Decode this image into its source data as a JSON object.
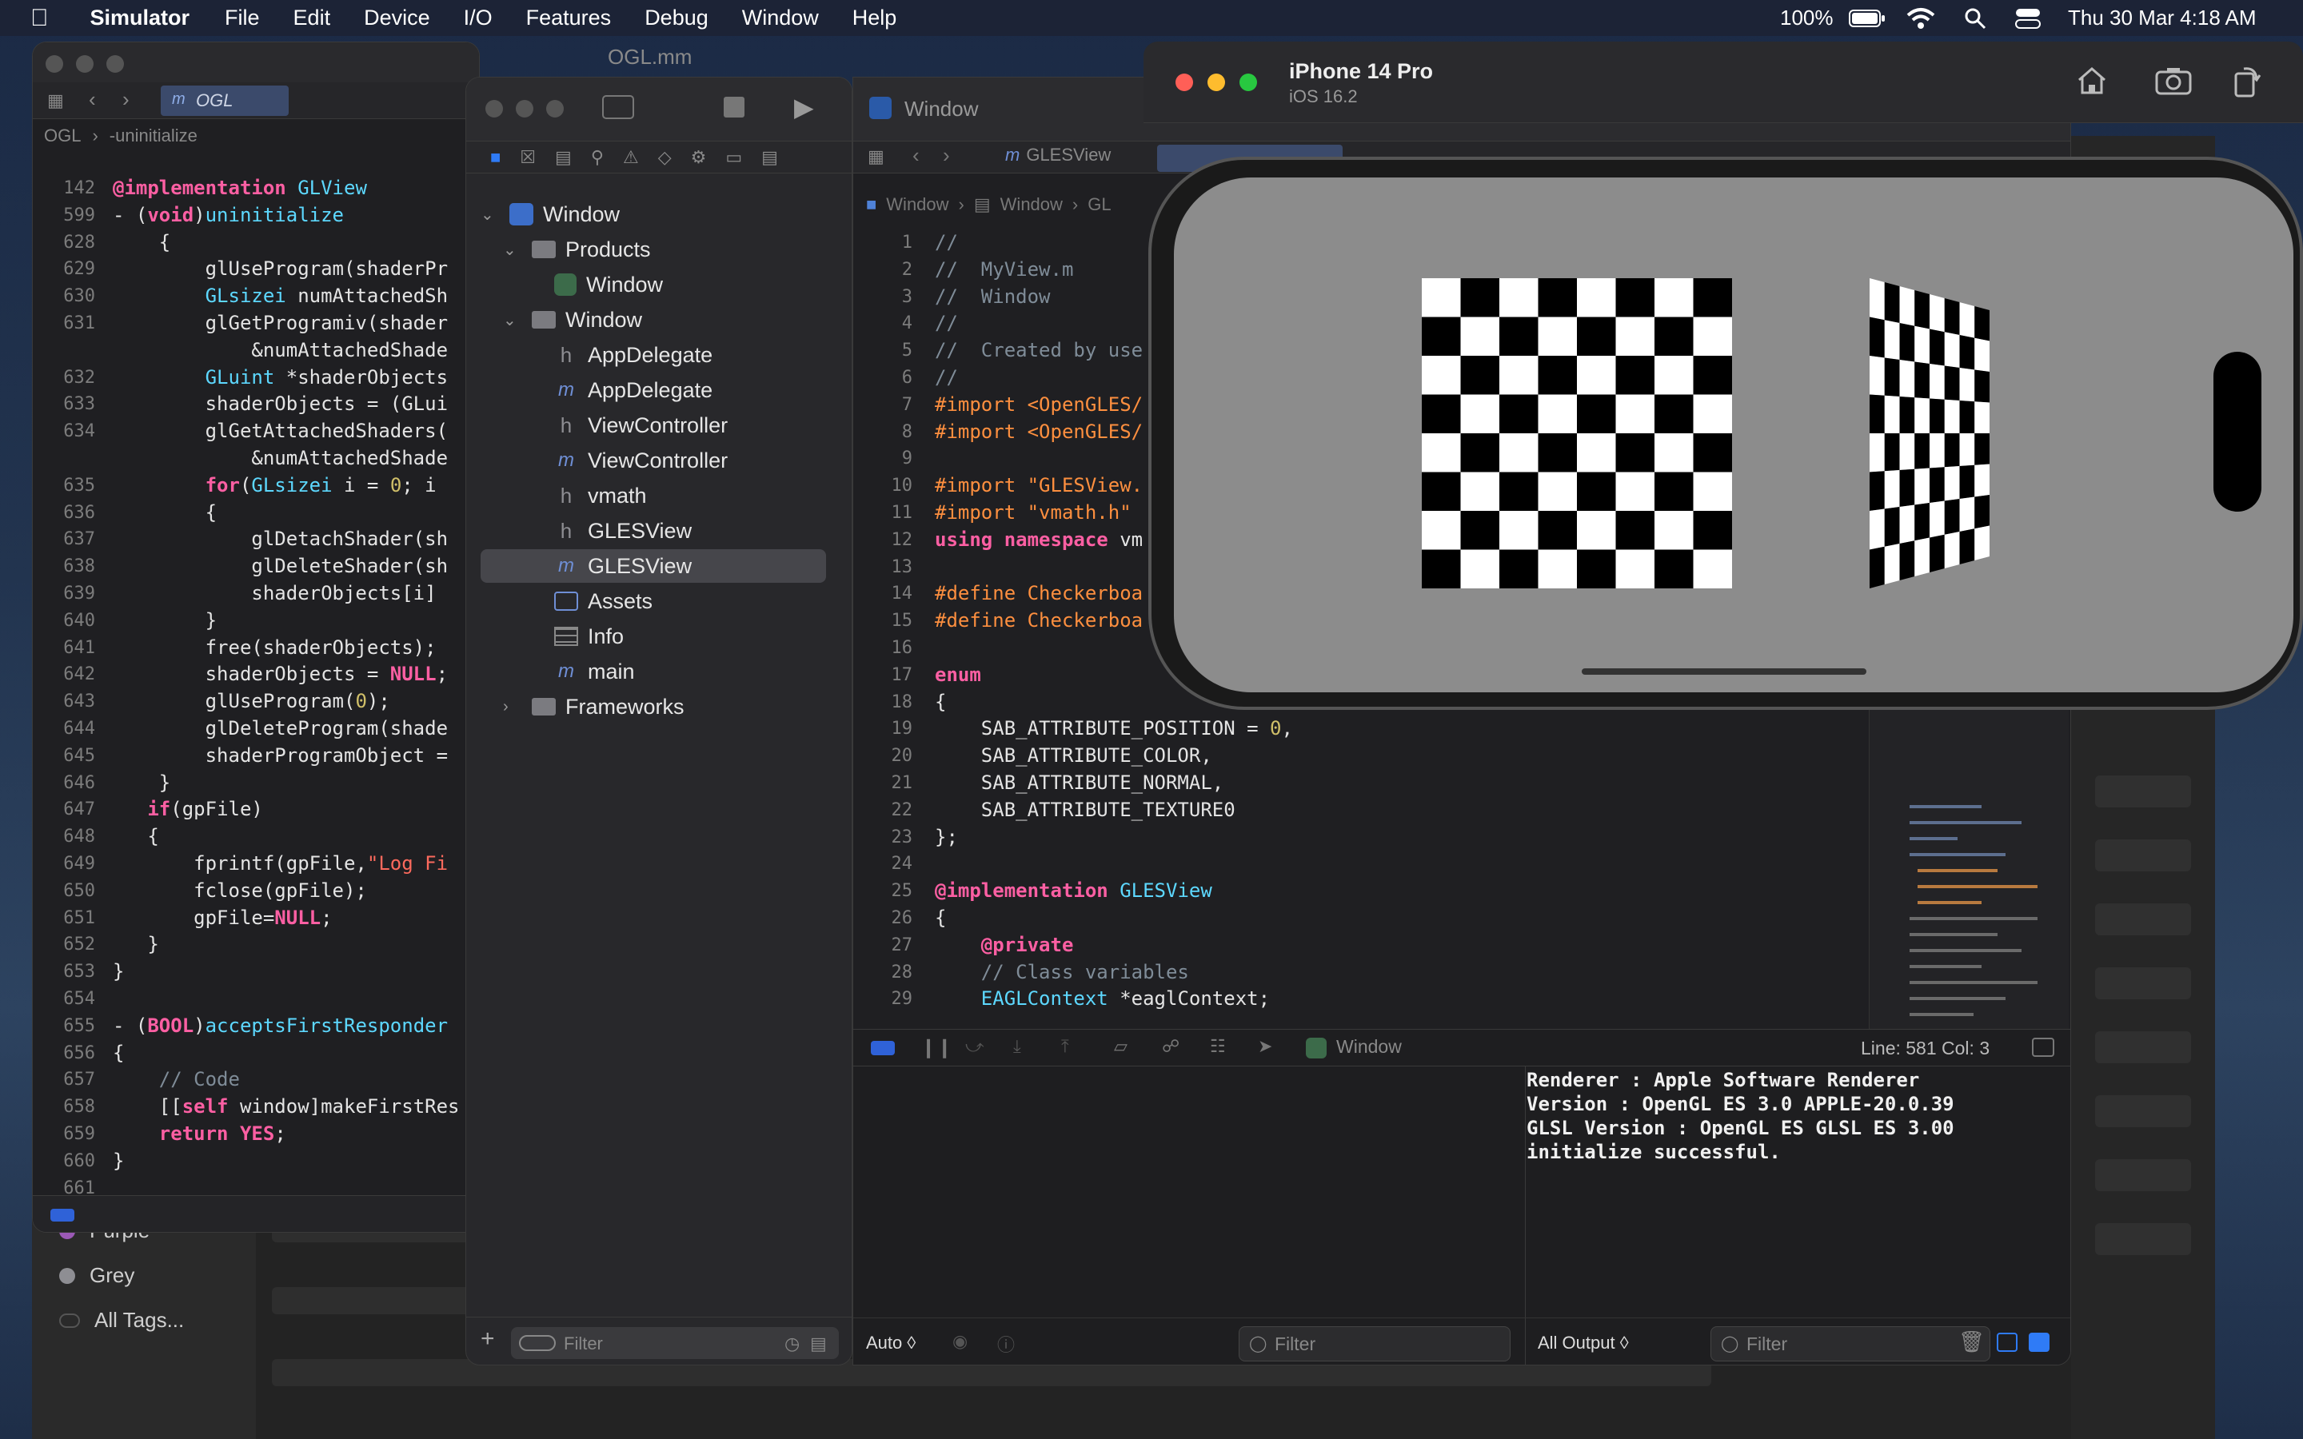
{
  "menubar": {
    "app_name": "Simulator",
    "items": [
      "File",
      "Edit",
      "Device",
      "I/O",
      "Features",
      "Debug",
      "Window",
      "Help"
    ],
    "battery": "100%",
    "datetime": "Thu 30 Mar  4:18 AM"
  },
  "notes_tags": {
    "items": [
      {
        "label": "Purple",
        "color": "#9b59b6"
      },
      {
        "label": "Grey",
        "color": "#8e8e93"
      },
      {
        "label": "All Tags...",
        "color": "#555555"
      }
    ]
  },
  "editor1": {
    "title": "OGL.mm",
    "tab": "OGL",
    "breadcrumb": [
      "OGL",
      "-uninitialize"
    ],
    "lines": [
      {
        "n": "142",
        "code": "@implementation GLView"
      },
      {
        "n": "599",
        "code": "- (void)uninitialize"
      },
      {
        "n": "628",
        "code": "    {"
      },
      {
        "n": "629",
        "code": "        glUseProgram(shaderPr"
      },
      {
        "n": "630",
        "code": "        GLsizei numAttachedSh"
      },
      {
        "n": "631",
        "code": "        glGetProgramiv(shader"
      },
      {
        "n": "",
        "code": "            &numAttachedShade"
      },
      {
        "n": "632",
        "code": "        GLuint *shaderObjects"
      },
      {
        "n": "633",
        "code": "        shaderObjects = (GLui"
      },
      {
        "n": "634",
        "code": "        glGetAttachedShaders("
      },
      {
        "n": "",
        "code": "            &numAttachedShade"
      },
      {
        "n": "635",
        "code": "        for(GLsizei i = 0; i"
      },
      {
        "n": "636",
        "code": "        {"
      },
      {
        "n": "637",
        "code": "            glDetachShader(sh"
      },
      {
        "n": "638",
        "code": "            glDeleteShader(sh"
      },
      {
        "n": "639",
        "code": "            shaderObjects[i]"
      },
      {
        "n": "640",
        "code": "        }"
      },
      {
        "n": "641",
        "code": "        free(shaderObjects);"
      },
      {
        "n": "642",
        "code": "        shaderObjects = NULL;"
      },
      {
        "n": "643",
        "code": "        glUseProgram(0);"
      },
      {
        "n": "644",
        "code": "        glDeleteProgram(shade"
      },
      {
        "n": "645",
        "code": "        shaderProgramObject ="
      },
      {
        "n": "646",
        "code": "    }"
      },
      {
        "n": "647",
        "code": "   if(gpFile)"
      },
      {
        "n": "648",
        "code": "   {"
      },
      {
        "n": "649",
        "code": "       fprintf(gpFile,\"Log Fi"
      },
      {
        "n": "650",
        "code": "       fclose(gpFile);"
      },
      {
        "n": "651",
        "code": "       gpFile=NULL;"
      },
      {
        "n": "652",
        "code": "   }"
      },
      {
        "n": "653",
        "code": "}"
      },
      {
        "n": "654",
        "code": ""
      },
      {
        "n": "655",
        "code": "- (BOOL)acceptsFirstResponder"
      },
      {
        "n": "656",
        "code": "{"
      },
      {
        "n": "657",
        "code": "    // Code"
      },
      {
        "n": "658",
        "code": "    [[self window]makeFirstRes"
      },
      {
        "n": "659",
        "code": "    return YES;"
      },
      {
        "n": "660",
        "code": "}"
      },
      {
        "n": "661",
        "code": ""
      }
    ]
  },
  "navigator": {
    "items": [
      {
        "label": "Window",
        "kind": "project",
        "indent": 0,
        "chevron": "open"
      },
      {
        "label": "Products",
        "kind": "folder",
        "indent": 1,
        "chevron": "open"
      },
      {
        "label": "Window",
        "kind": "app",
        "indent": 2,
        "chevron": ""
      },
      {
        "label": "Window",
        "kind": "folder",
        "indent": 1,
        "chevron": "open"
      },
      {
        "label": "AppDelegate",
        "kind": "h",
        "indent": 2,
        "chevron": ""
      },
      {
        "label": "AppDelegate",
        "kind": "m",
        "indent": 2,
        "chevron": ""
      },
      {
        "label": "ViewController",
        "kind": "h",
        "indent": 2,
        "chevron": ""
      },
      {
        "label": "ViewController",
        "kind": "m",
        "indent": 2,
        "chevron": ""
      },
      {
        "label": "vmath",
        "kind": "h",
        "indent": 2,
        "chevron": ""
      },
      {
        "label": "GLESView",
        "kind": "h",
        "indent": 2,
        "chevron": ""
      },
      {
        "label": "GLESView",
        "kind": "m",
        "indent": 2,
        "chevron": "",
        "selected": true
      },
      {
        "label": "Assets",
        "kind": "assets",
        "indent": 2,
        "chevron": ""
      },
      {
        "label": "Info",
        "kind": "plist",
        "indent": 2,
        "chevron": ""
      },
      {
        "label": "main",
        "kind": "m",
        "indent": 2,
        "chevron": ""
      },
      {
        "label": "Frameworks",
        "kind": "folder",
        "indent": 1,
        "chevron": "closed"
      }
    ],
    "filter_placeholder": "Filter"
  },
  "main_editor": {
    "title": "Window",
    "tab": "GLESView",
    "breadcrumb": [
      "Window",
      "Window",
      "GL"
    ],
    "lines": [
      {
        "n": "1",
        "code": "//"
      },
      {
        "n": "2",
        "code": "//  MyView.m"
      },
      {
        "n": "3",
        "code": "//  Window"
      },
      {
        "n": "4",
        "code": "//"
      },
      {
        "n": "5",
        "code": "//  Created by use"
      },
      {
        "n": "6",
        "code": "//"
      },
      {
        "n": "7",
        "code": "#import <OpenGLES/"
      },
      {
        "n": "8",
        "code": "#import <OpenGLES/"
      },
      {
        "n": "9",
        "code": ""
      },
      {
        "n": "10",
        "code": "#import \"GLESView."
      },
      {
        "n": "11",
        "code": "#import \"vmath.h\""
      },
      {
        "n": "12",
        "code": "using namespace vm"
      },
      {
        "n": "13",
        "code": ""
      },
      {
        "n": "14",
        "code": "#define Checkerboa"
      },
      {
        "n": "15",
        "code": "#define Checkerboa"
      },
      {
        "n": "16",
        "code": ""
      },
      {
        "n": "17",
        "code": "enum"
      },
      {
        "n": "18",
        "code": "{"
      },
      {
        "n": "19",
        "code": "    SAB_ATTRIBUTE_POSITION = 0,"
      },
      {
        "n": "20",
        "code": "    SAB_ATTRIBUTE_COLOR,"
      },
      {
        "n": "21",
        "code": "    SAB_ATTRIBUTE_NORMAL,"
      },
      {
        "n": "22",
        "code": "    SAB_ATTRIBUTE_TEXTURE0"
      },
      {
        "n": "23",
        "code": "};"
      },
      {
        "n": "24",
        "code": ""
      },
      {
        "n": "25",
        "code": "@implementation GLESView"
      },
      {
        "n": "26",
        "code": "{"
      },
      {
        "n": "27",
        "code": "    @private"
      },
      {
        "n": "28",
        "code": "    // Class variables"
      },
      {
        "n": "29",
        "code": "    EAGLContext *eaglContext;"
      }
    ]
  },
  "debug": {
    "scheme": "Window",
    "position": "Line: 581  Col: 3",
    "auto_label": "Auto ◊",
    "filter_placeholder": "Filter",
    "output_label": "All Output ◊",
    "console": "Renderer : Apple Software Renderer\nVersion : OpenGL ES 3.0 APPLE-20.0.39\nGLSL Version : OpenGL ES GLSL ES 3.00\ninitialize successful."
  },
  "simulator": {
    "device": "iPhone 14 Pro",
    "os": "iOS 16.2",
    "icons": [
      "home-icon",
      "screenshot-icon",
      "rotate-icon"
    ]
  }
}
